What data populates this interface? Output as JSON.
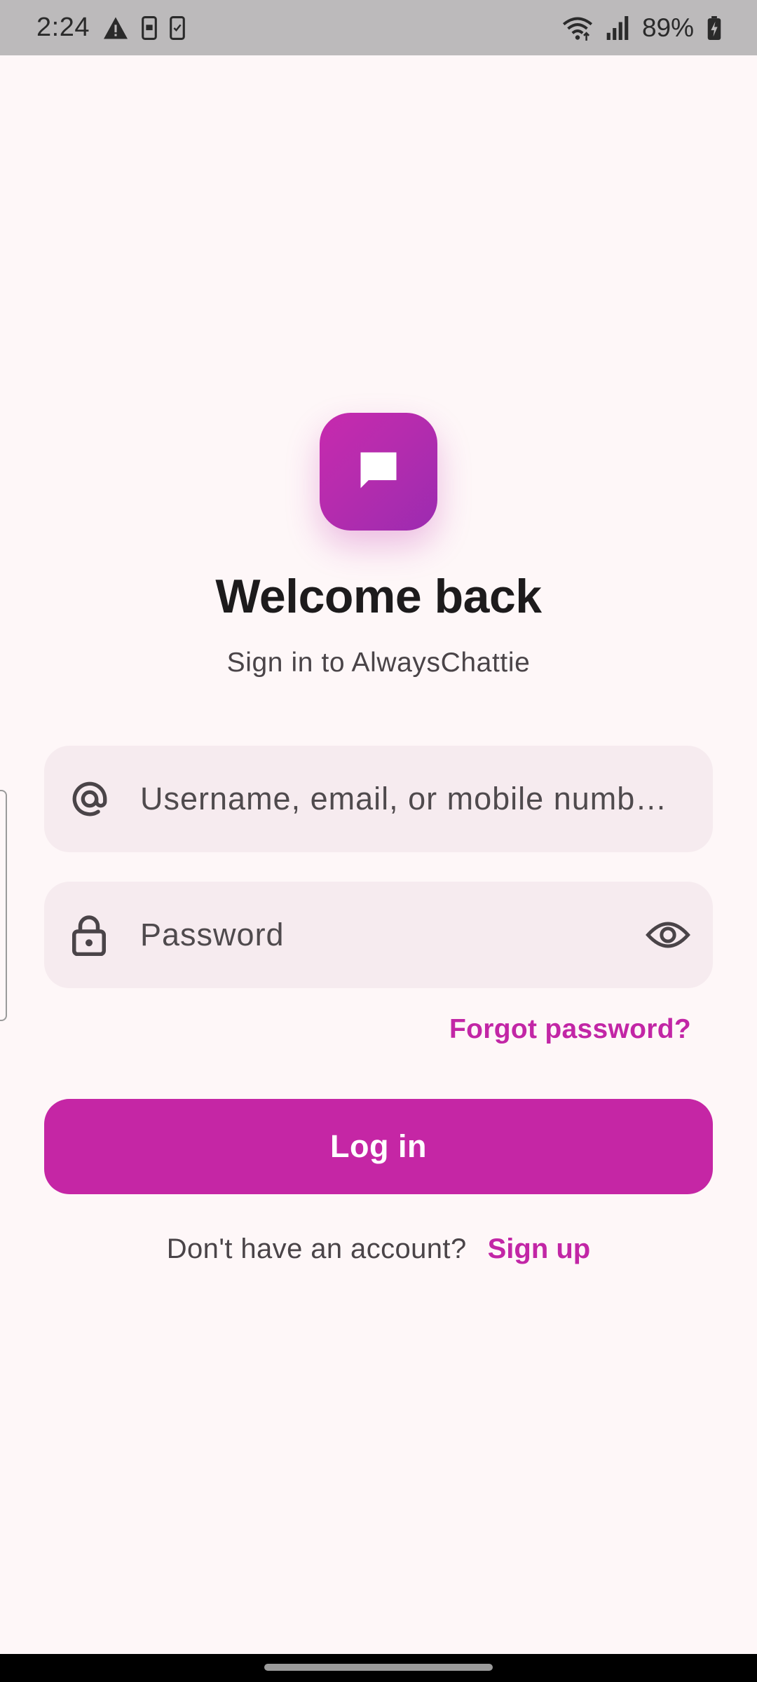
{
  "status_bar": {
    "time": "2:24",
    "battery_percent": "89%",
    "icons": [
      "warning-icon",
      "phone-notification-icon",
      "phone-check-icon",
      "wifi-icon",
      "signal-icon",
      "battery-charging-icon"
    ]
  },
  "app": {
    "logo_icon": "chat-bubble-icon",
    "title": "Welcome back",
    "subtitle": "Sign in to AlwaysChattie"
  },
  "form": {
    "username": {
      "icon": "at-sign-icon",
      "value": "",
      "placeholder": "Username, email, or mobile numb…"
    },
    "password": {
      "icon": "lock-icon",
      "value": "",
      "placeholder": "Password",
      "toggle_icon": "eye-icon"
    },
    "forgot_label": "Forgot password?",
    "login_label": "Log in"
  },
  "signup": {
    "prompt": "Don't have an account?",
    "link": "Sign up"
  },
  "colors": {
    "background": "#FEF7F8",
    "accent": "#C526A5",
    "field_bg": "#F6EBEF",
    "status_bar_bg": "#BCBABB"
  }
}
